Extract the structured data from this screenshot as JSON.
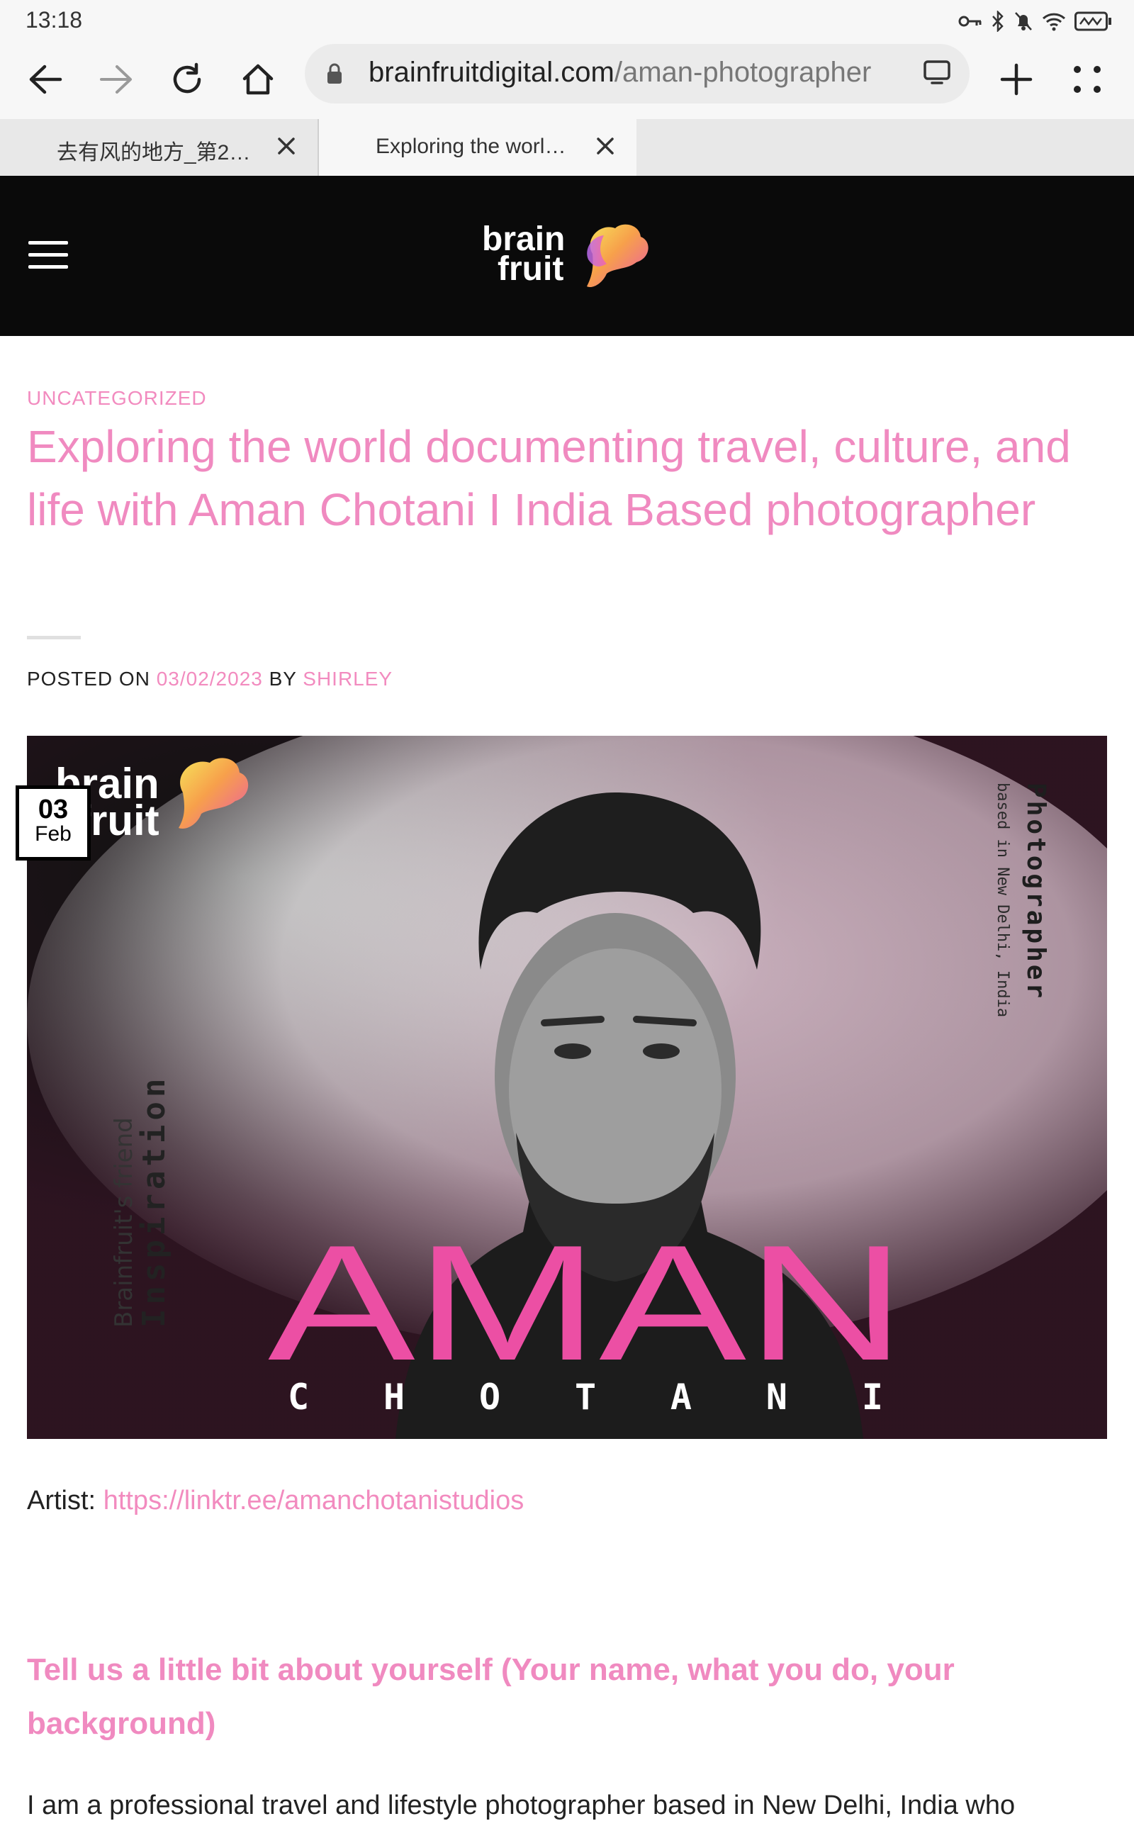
{
  "status_bar": {
    "time": "13:18"
  },
  "browser": {
    "url_domain": "brainfruitdigital.com",
    "url_path": "/aman-photographer",
    "tabs": [
      {
        "label": "去有风的地方_第25…",
        "active": false
      },
      {
        "label": "Exploring the worl…",
        "active": true
      }
    ]
  },
  "site": {
    "logo_line1": "brain",
    "logo_line2": "fruit"
  },
  "article": {
    "category": "UNCATEGORIZED",
    "title": "Exploring the world documenting travel, culture, and life with Aman Chotani I India Based photographer",
    "posted_on_label": "POSTED ON",
    "date": "03/02/2023",
    "by_label": "BY",
    "author": "SHIRLEY",
    "date_badge": {
      "day": "03",
      "month": "Feb"
    },
    "hero": {
      "logo_line1": "brain",
      "logo_line2": "fruit",
      "side_left_small": "Brainfruit's friend",
      "side_left_big": "Inspiration",
      "side_right_big": "Photographer",
      "side_right_small": "based in New Delhi, India",
      "first_name": "AMAN",
      "last_name": "C H O T A N I"
    },
    "artist_label": "Artist:",
    "artist_link": "https://linktr.ee/amanchotanistudios",
    "question": "Tell us a little bit about yourself (Your name, what you do, your background)",
    "body_start": "I am a professional travel and lifestyle photographer based in New Delhi, India who"
  },
  "colors": {
    "accent_pink": "#f08ac0",
    "header_bg": "#0a0a0a"
  }
}
